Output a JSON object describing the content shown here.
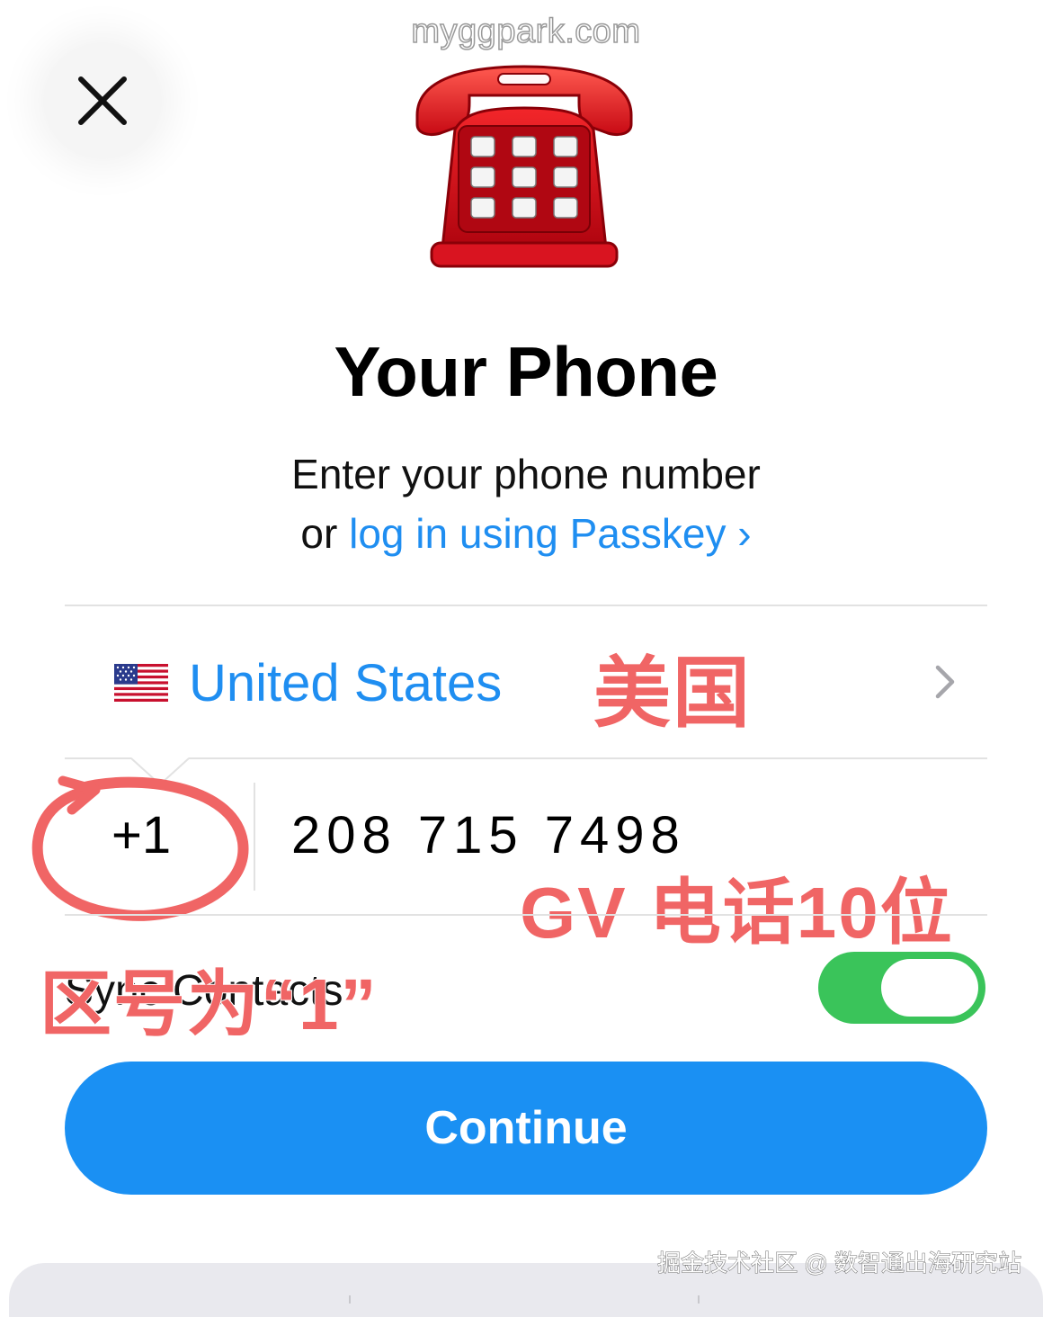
{
  "watermark": {
    "top": "myggpark.com",
    "bottom": "掘金技术社区 @ 数智通出海研究站"
  },
  "header": {
    "close_icon": "close-icon",
    "hero_icon": "telephone-icon"
  },
  "title": "Your Phone",
  "subtitle": {
    "line1": "Enter your phone number",
    "line2_prefix": "or ",
    "passkey_link": "log in using Passkey",
    "link_chevron": "›"
  },
  "country": {
    "flag_icon": "us-flag-icon",
    "name": "United States",
    "chevron_icon": "chevron-right-icon"
  },
  "phone": {
    "code": "+1",
    "number": "208 715 7498"
  },
  "sync_contacts": {
    "label": "Sync Contacts",
    "enabled": true
  },
  "continue_label": "Continue",
  "annotations": {
    "country_note": "美国",
    "number_note": "GV 电话10位",
    "code_note": "区号为“1”"
  },
  "colors": {
    "accent": "#1f8ef1",
    "button": "#1a90f3",
    "toggle_on": "#3ac45a",
    "annotation": "#f06565"
  }
}
